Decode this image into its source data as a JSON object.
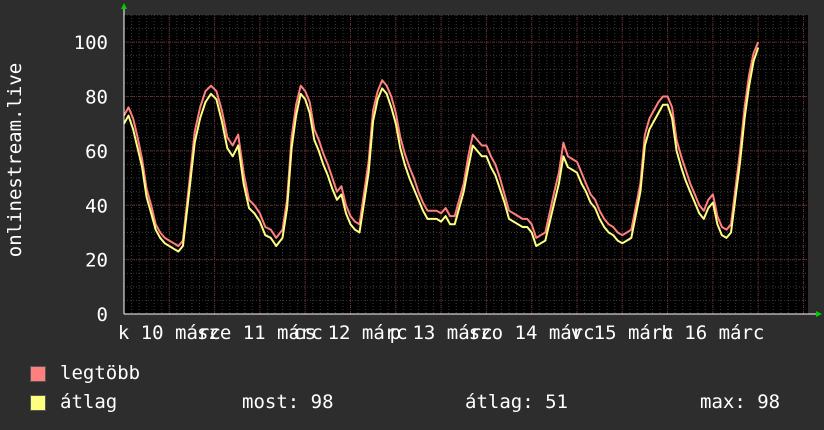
{
  "chart_data": {
    "type": "line",
    "ylabel": "onlinestream.live",
    "ylim": [
      0,
      110
    ],
    "yticks": [
      0,
      20,
      40,
      60,
      80,
      100
    ],
    "grid": true,
    "x_tick_labels": [
      "k 10 márc",
      "sze 11 márc",
      "cs 12 márc",
      "p 13 márc",
      "szo 14 márc",
      "v 15 márc",
      "h 16 márc"
    ],
    "x_range_days": [
      0,
      7.55
    ],
    "series": [
      {
        "name": "legtöbb",
        "color": "#ff7f7f",
        "points": [
          [
            0.0,
            73
          ],
          [
            0.05,
            76
          ],
          [
            0.1,
            72
          ],
          [
            0.15,
            65
          ],
          [
            0.2,
            57
          ],
          [
            0.25,
            46
          ],
          [
            0.3,
            40
          ],
          [
            0.35,
            33
          ],
          [
            0.4,
            30
          ],
          [
            0.45,
            28
          ],
          [
            0.5,
            27
          ],
          [
            0.55,
            26
          ],
          [
            0.6,
            25
          ],
          [
            0.65,
            27
          ],
          [
            0.72,
            48
          ],
          [
            0.78,
            67
          ],
          [
            0.84,
            76
          ],
          [
            0.9,
            82
          ],
          [
            0.96,
            84
          ],
          [
            1.02,
            82
          ],
          [
            1.08,
            75
          ],
          [
            1.14,
            65
          ],
          [
            1.2,
            62
          ],
          [
            1.26,
            66
          ],
          [
            1.32,
            52
          ],
          [
            1.38,
            42
          ],
          [
            1.44,
            40
          ],
          [
            1.5,
            37
          ],
          [
            1.56,
            32
          ],
          [
            1.62,
            31
          ],
          [
            1.68,
            28
          ],
          [
            1.75,
            31
          ],
          [
            1.8,
            42
          ],
          [
            1.85,
            65
          ],
          [
            1.9,
            77
          ],
          [
            1.95,
            84
          ],
          [
            2.0,
            82
          ],
          [
            2.05,
            78
          ],
          [
            2.1,
            68
          ],
          [
            2.15,
            64
          ],
          [
            2.2,
            59
          ],
          [
            2.25,
            55
          ],
          [
            2.3,
            50
          ],
          [
            2.35,
            45
          ],
          [
            2.4,
            47
          ],
          [
            2.45,
            40
          ],
          [
            2.5,
            36
          ],
          [
            2.55,
            34
          ],
          [
            2.6,
            33
          ],
          [
            2.7,
            56
          ],
          [
            2.75,
            75
          ],
          [
            2.8,
            82
          ],
          [
            2.85,
            86
          ],
          [
            2.9,
            84
          ],
          [
            2.95,
            80
          ],
          [
            3.0,
            74
          ],
          [
            3.05,
            65
          ],
          [
            3.1,
            59
          ],
          [
            3.15,
            54
          ],
          [
            3.2,
            50
          ],
          [
            3.25,
            45
          ],
          [
            3.3,
            41
          ],
          [
            3.35,
            38
          ],
          [
            3.4,
            38
          ],
          [
            3.45,
            38
          ],
          [
            3.5,
            37
          ],
          [
            3.55,
            39
          ],
          [
            3.6,
            36
          ],
          [
            3.65,
            36
          ],
          [
            3.75,
            48
          ],
          [
            3.8,
            58
          ],
          [
            3.85,
            66
          ],
          [
            3.9,
            64
          ],
          [
            3.95,
            62
          ],
          [
            4.0,
            62
          ],
          [
            4.05,
            58
          ],
          [
            4.1,
            55
          ],
          [
            4.15,
            50
          ],
          [
            4.2,
            44
          ],
          [
            4.25,
            38
          ],
          [
            4.3,
            37
          ],
          [
            4.35,
            36
          ],
          [
            4.4,
            35
          ],
          [
            4.45,
            35
          ],
          [
            4.5,
            33
          ],
          [
            4.55,
            28
          ],
          [
            4.6,
            29
          ],
          [
            4.65,
            30
          ],
          [
            4.75,
            45
          ],
          [
            4.8,
            52
          ],
          [
            4.85,
            63
          ],
          [
            4.9,
            58
          ],
          [
            4.95,
            57
          ],
          [
            5.0,
            56
          ],
          [
            5.05,
            52
          ],
          [
            5.1,
            48
          ],
          [
            5.15,
            44
          ],
          [
            5.2,
            42
          ],
          [
            5.25,
            38
          ],
          [
            5.3,
            35
          ],
          [
            5.35,
            33
          ],
          [
            5.4,
            32
          ],
          [
            5.45,
            30
          ],
          [
            5.5,
            29
          ],
          [
            5.55,
            30
          ],
          [
            5.6,
            31
          ],
          [
            5.7,
            48
          ],
          [
            5.75,
            66
          ],
          [
            5.8,
            72
          ],
          [
            5.85,
            75
          ],
          [
            5.9,
            78
          ],
          [
            5.95,
            80
          ],
          [
            6.0,
            80
          ],
          [
            6.05,
            76
          ],
          [
            6.1,
            64
          ],
          [
            6.15,
            58
          ],
          [
            6.2,
            53
          ],
          [
            6.25,
            48
          ],
          [
            6.3,
            44
          ],
          [
            6.35,
            40
          ],
          [
            6.4,
            38
          ],
          [
            6.45,
            42
          ],
          [
            6.5,
            44
          ],
          [
            6.55,
            36
          ],
          [
            6.6,
            32
          ],
          [
            6.65,
            31
          ],
          [
            6.7,
            33
          ],
          [
            6.8,
            60
          ],
          [
            6.85,
            76
          ],
          [
            6.9,
            88
          ],
          [
            6.95,
            96
          ],
          [
            7.0,
            100
          ]
        ]
      },
      {
        "name": "átlag",
        "color": "#ffff7f",
        "points": [
          [
            0.0,
            70
          ],
          [
            0.05,
            73
          ],
          [
            0.1,
            68
          ],
          [
            0.15,
            61
          ],
          [
            0.2,
            54
          ],
          [
            0.25,
            43
          ],
          [
            0.3,
            37
          ],
          [
            0.35,
            31
          ],
          [
            0.4,
            28
          ],
          [
            0.45,
            26
          ],
          [
            0.5,
            25
          ],
          [
            0.55,
            24
          ],
          [
            0.6,
            23
          ],
          [
            0.65,
            25
          ],
          [
            0.72,
            45
          ],
          [
            0.78,
            63
          ],
          [
            0.84,
            72
          ],
          [
            0.9,
            78
          ],
          [
            0.96,
            81
          ],
          [
            1.02,
            79
          ],
          [
            1.08,
            71
          ],
          [
            1.14,
            61
          ],
          [
            1.2,
            58
          ],
          [
            1.26,
            62
          ],
          [
            1.32,
            48
          ],
          [
            1.38,
            39
          ],
          [
            1.44,
            37
          ],
          [
            1.5,
            34
          ],
          [
            1.56,
            29
          ],
          [
            1.62,
            28
          ],
          [
            1.68,
            25
          ],
          [
            1.75,
            28
          ],
          [
            1.8,
            39
          ],
          [
            1.85,
            61
          ],
          [
            1.9,
            73
          ],
          [
            1.95,
            81
          ],
          [
            2.0,
            79
          ],
          [
            2.05,
            74
          ],
          [
            2.1,
            64
          ],
          [
            2.15,
            60
          ],
          [
            2.2,
            55
          ],
          [
            2.25,
            51
          ],
          [
            2.3,
            46
          ],
          [
            2.35,
            42
          ],
          [
            2.4,
            44
          ],
          [
            2.45,
            37
          ],
          [
            2.5,
            33
          ],
          [
            2.55,
            31
          ],
          [
            2.6,
            30
          ],
          [
            2.7,
            52
          ],
          [
            2.75,
            71
          ],
          [
            2.8,
            79
          ],
          [
            2.85,
            83
          ],
          [
            2.9,
            81
          ],
          [
            2.95,
            76
          ],
          [
            3.0,
            70
          ],
          [
            3.05,
            61
          ],
          [
            3.1,
            55
          ],
          [
            3.15,
            50
          ],
          [
            3.2,
            46
          ],
          [
            3.25,
            42
          ],
          [
            3.3,
            38
          ],
          [
            3.35,
            35
          ],
          [
            3.4,
            35
          ],
          [
            3.45,
            35
          ],
          [
            3.5,
            34
          ],
          [
            3.55,
            36
          ],
          [
            3.6,
            33
          ],
          [
            3.65,
            33
          ],
          [
            3.75,
            45
          ],
          [
            3.8,
            54
          ],
          [
            3.85,
            62
          ],
          [
            3.9,
            60
          ],
          [
            3.95,
            58
          ],
          [
            4.0,
            58
          ],
          [
            4.05,
            54
          ],
          [
            4.1,
            51
          ],
          [
            4.15,
            46
          ],
          [
            4.2,
            41
          ],
          [
            4.25,
            35
          ],
          [
            4.3,
            34
          ],
          [
            4.35,
            33
          ],
          [
            4.4,
            32
          ],
          [
            4.45,
            32
          ],
          [
            4.5,
            30
          ],
          [
            4.55,
            25
          ],
          [
            4.6,
            26
          ],
          [
            4.65,
            27
          ],
          [
            4.75,
            41
          ],
          [
            4.8,
            48
          ],
          [
            4.85,
            58
          ],
          [
            4.9,
            54
          ],
          [
            4.95,
            53
          ],
          [
            5.0,
            52
          ],
          [
            5.05,
            48
          ],
          [
            5.1,
            45
          ],
          [
            5.15,
            41
          ],
          [
            5.2,
            39
          ],
          [
            5.25,
            35
          ],
          [
            5.3,
            32
          ],
          [
            5.35,
            30
          ],
          [
            5.4,
            29
          ],
          [
            5.45,
            27
          ],
          [
            5.5,
            26
          ],
          [
            5.55,
            27
          ],
          [
            5.6,
            28
          ],
          [
            5.7,
            45
          ],
          [
            5.75,
            62
          ],
          [
            5.8,
            68
          ],
          [
            5.85,
            71
          ],
          [
            5.9,
            74
          ],
          [
            5.95,
            77
          ],
          [
            6.0,
            77
          ],
          [
            6.05,
            72
          ],
          [
            6.1,
            60
          ],
          [
            6.15,
            54
          ],
          [
            6.2,
            49
          ],
          [
            6.25,
            45
          ],
          [
            6.3,
            41
          ],
          [
            6.35,
            37
          ],
          [
            6.4,
            35
          ],
          [
            6.45,
            39
          ],
          [
            6.5,
            41
          ],
          [
            6.55,
            33
          ],
          [
            6.6,
            29
          ],
          [
            6.65,
            28
          ],
          [
            6.7,
            30
          ],
          [
            6.8,
            56
          ],
          [
            6.85,
            72
          ],
          [
            6.9,
            84
          ],
          [
            6.95,
            93
          ],
          [
            7.0,
            98
          ]
        ]
      }
    ]
  },
  "legend": [
    {
      "label": "legtöbb",
      "color": "#ff7f7f"
    },
    {
      "label": "átlag",
      "color": "#ffff7f"
    }
  ],
  "stats": {
    "now_label": "most:",
    "now_value": "98",
    "avg_label": "átlag:",
    "avg_value": "51",
    "max_label": "max:",
    "max_value": "98"
  }
}
